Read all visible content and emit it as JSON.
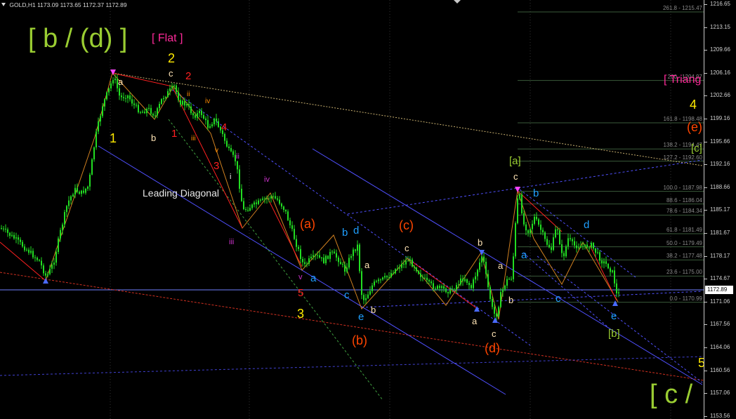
{
  "header": {
    "symbol": "GOLD,H1",
    "open": "1173.09",
    "high": "1173.65",
    "low": "1172.37",
    "close": "1172.89"
  },
  "price_axis": {
    "labels": [
      "1216.65",
      "1213.15",
      "1209.66",
      "1206.16",
      "1202.66",
      "1199.16",
      "1195.66",
      "1192.16",
      "1188.66",
      "1185.17",
      "1181.67",
      "1178.17",
      "1174.67",
      "1171.06",
      "1167.56",
      "1164.06",
      "1160.56",
      "1157.06",
      "1153.56"
    ],
    "current_price": "1172.89"
  },
  "fib_levels": [
    {
      "ratio": "261.8 - 1215.47",
      "level": 261.8
    },
    {
      "ratio": "200 - 1204.97",
      "level": 200
    },
    {
      "ratio": "161.8 - 1198.48",
      "level": 161.8
    },
    {
      "ratio": "138.2 - 1194.47",
      "level": 138.2
    },
    {
      "ratio": "127.2 - 1192.60",
      "level": 127.2
    },
    {
      "ratio": "100.0 - 1187.98",
      "level": 100
    },
    {
      "ratio": "88.6 - 1186.04",
      "level": 88.6
    },
    {
      "ratio": "78.6 - 1184.34",
      "level": 78.6
    },
    {
      "ratio": "61.8 - 1181.49",
      "level": 61.8
    },
    {
      "ratio": "50.0 - 1179.49",
      "level": 50
    },
    {
      "ratio": "38.2 - 1177.48",
      "level": 38.2
    },
    {
      "ratio": "23.6 - 1175.00",
      "level": 23.6
    },
    {
      "ratio": "0.0 - 1170.99",
      "level": 0
    }
  ],
  "wave_labels": {
    "big_b_d": "[ b / (d) ]",
    "flat": "[ Flat ]",
    "triangle": "[ Triang",
    "big_c": "[ c /",
    "leading_diagonal": "Leading Diagonal",
    "w1": "1",
    "w2": "2",
    "w3": "3",
    "w4": "4",
    "w5": "5",
    "r1": "1",
    "r2": "2",
    "r3": "3",
    "r4": "4",
    "r5": "5",
    "ri": "i",
    "rii": "ii",
    "riii": "iii",
    "riv": "iv",
    "rv": "v",
    "mi": "i",
    "mii": "ii",
    "miii": "iii",
    "miv": "iv",
    "mv": "v",
    "pa": "(a)",
    "pb": "(b)",
    "pc": "(c)",
    "pd": "(d)",
    "pe": "(e)",
    "ba": "[a]",
    "bb": "[b]",
    "bc": "[c]",
    "la1": "a",
    "lb1": "b",
    "lc1": "c",
    "la2": "a",
    "lb2": "b",
    "lc2": "c",
    "la3": "a",
    "lb3": "b",
    "lc3": "c",
    "lb_blue": "b",
    "ld_blue": "d",
    "lc_blue": "c",
    "le_blue": "e",
    "la_blue": "a",
    "la4": "a",
    "lb4": "b",
    "lc4": "c",
    "la5": "a",
    "lb5": "b",
    "lc5": "c",
    "la_blue2": "a",
    "lb_blue2": "b",
    "lc_blue2": "c",
    "ld_blue2": "d",
    "le_blue2": "e",
    "ld_blue3": "d",
    "ab_blue": "a",
    "ab_w": "a",
    "bb_w": "b",
    "c_top": "c",
    "c_top2": "c",
    "b_top": "b"
  },
  "colors": {
    "background": "#000000",
    "candle": "#22dd22",
    "yellow_green": "#9acd32",
    "magenta": "#ff2a9a",
    "orange_red": "#ff4500",
    "yellow": "#ffea00",
    "blue_label": "#1e9fff",
    "channel_blue": "#5050ff",
    "cream": "#ffe4b5"
  }
}
